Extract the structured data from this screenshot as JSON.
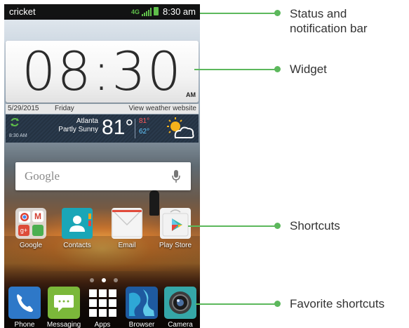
{
  "status_bar": {
    "carrier": "cricket",
    "network": "4G",
    "time": "8:30 am"
  },
  "widget": {
    "time": "08:30",
    "ampm": "AM",
    "date": "5/29/2015",
    "day": "Friday",
    "weather_link": "View weather website",
    "updated_time": "8:30 AM",
    "location": "Atlanta",
    "condition": "Partly Sunny",
    "temperature": "81°",
    "high": "81°",
    "low": "62°",
    "weather_icon": "partly-sunny-icon"
  },
  "search": {
    "logo": "Google",
    "mic_icon": "mic-icon"
  },
  "shortcuts": [
    {
      "label": "Google",
      "icon": "google-folder-icon"
    },
    {
      "label": "Contacts",
      "icon": "contacts-icon"
    },
    {
      "label": "Email",
      "icon": "email-icon"
    },
    {
      "label": "Play Store",
      "icon": "play-store-icon"
    }
  ],
  "page_indicator": {
    "count": 3,
    "active": 1
  },
  "favorites": [
    {
      "label": "Phone",
      "icon": "phone-icon"
    },
    {
      "label": "Messaging",
      "icon": "messaging-icon"
    },
    {
      "label": "Apps",
      "icon": "apps-grid-icon"
    },
    {
      "label": "Browser",
      "icon": "browser-icon"
    },
    {
      "label": "Camera",
      "icon": "camera-icon"
    }
  ],
  "callouts": {
    "status": "Status and notification bar",
    "status_line1": "Status and",
    "status_line2": "notification bar",
    "widget": "Widget",
    "shortcuts": "Shortcuts",
    "favorites": "Favorite shortcuts"
  },
  "colors": {
    "callout": "#5cb85c",
    "status_bar": "#000000",
    "accent_green": "#5fbf4a",
    "high_temp": "#ff5a5a",
    "low_temp": "#62c8ff"
  }
}
